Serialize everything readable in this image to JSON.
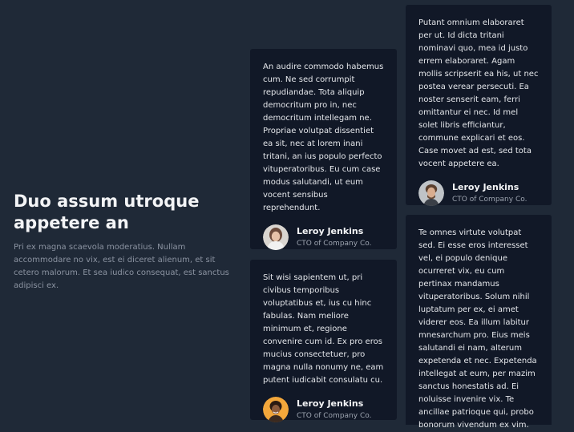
{
  "intro": {
    "heading": "Duo assum utroque appetere an",
    "text": "Pri ex magna scaevola moderatius. Nullam accommodare no vix, est ei diceret alienum, et sit cetero malorum. Et sea iudico consequat, est sanctus adipisci ex."
  },
  "testimonials": [
    {
      "quote": "An audire commodo habemus cum. Ne sed corrumpit repudiandae. Tota aliquip democritum pro in, nec democritum intellegam ne. Propriae volutpat dissentiet ea sit, nec at lorem inani tritani, an ius populo perfecto vituperatoribus. Eu cum case modus salutandi, ut eum vocent sensibus reprehendunt.",
      "name": "Leroy Jenkins",
      "role": "CTO of Company Co.",
      "avatar_icon": "woman-portrait-avatar"
    },
    {
      "quote": "Sit wisi sapientem ut, pri civibus temporibus voluptatibus et, ius cu hinc fabulas. Nam meliore minimum et, regione convenire cum id. Ex pro eros mucius consectetuer, pro magna nulla nonumy ne, eam putent iudicabit consulatu cu.",
      "name": "Leroy Jenkins",
      "role": "CTO of Company Co.",
      "avatar_icon": "smiling-woman-avatar"
    },
    {
      "quote": "Putant omnium elaboraret per ut. Id dicta tritani nominavi quo, mea id justo errem elaboraret. Agam mollis scripserit ea his, ut nec postea verear persecuti. Ea noster senserit eam, ferri omittantur ei nec. Id mel solet libris efficiantur, commune explicari et eos. Case movet ad est, sed tota vocent appetere ea.",
      "name": "Leroy Jenkins",
      "role": "CTO of Company Co.",
      "avatar_icon": "man-portrait-avatar"
    },
    {
      "quote": "Te omnes virtute volutpat sed. Ei esse eros interesset vel, ei populo denique ocurreret vix, eu cum pertinax mandamus vituperatoribus. Solum nihil luptatum per ex, ei amet viderer eos. Ea illum labitur mnesarchum pro. Eius meis salutandi ei nam, alterum expetenda et nec. Expetenda intellegat at eum, per mazim sanctus honestatis ad. Ei noluisse invenire vix. Te ancillae patrioque qui, probo bonorum vivendum ex vim."
    }
  ]
}
